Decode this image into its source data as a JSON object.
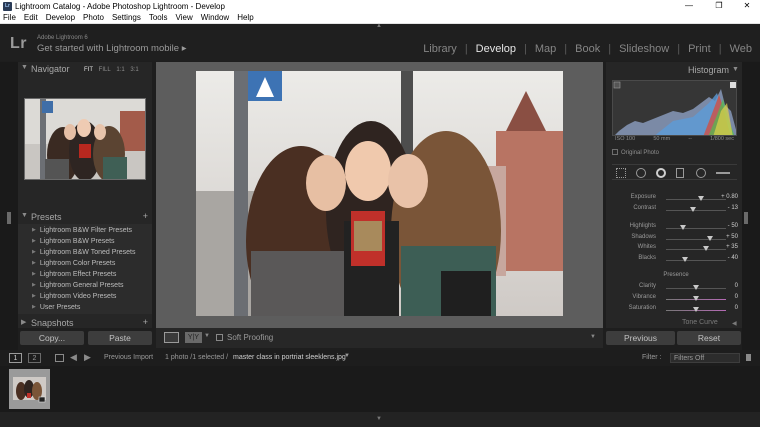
{
  "window": {
    "title": "Lightroom Catalog - Adobe Photoshop Lightroom - Develop",
    "controls": {
      "minimize": "—",
      "maximize": "❐",
      "close": "✕"
    }
  },
  "menu": [
    "File",
    "Edit",
    "Develop",
    "Photo",
    "Settings",
    "Tools",
    "View",
    "Window",
    "Help"
  ],
  "header": {
    "logo": "Lr",
    "product": "Adobe Lightroom 6",
    "mobile_prompt": "Get started with Lightroom mobile",
    "mobile_arrow": "▸",
    "modules": [
      "Library",
      "Develop",
      "Map",
      "Book",
      "Slideshow",
      "Print",
      "Web"
    ],
    "active_module": "Develop"
  },
  "left_panel": {
    "navigator": {
      "title": "Navigator",
      "options": [
        "FIT",
        "FILL",
        "1:1",
        "3:1"
      ],
      "active_option": "FIT"
    },
    "presets": {
      "title": "Presets",
      "add": "+",
      "items": [
        "Lightroom B&W Filter Presets",
        "Lightroom B&W Presets",
        "Lightroom B&W Toned Presets",
        "Lightroom Color Presets",
        "Lightroom Effect Presets",
        "Lightroom General Presets",
        "Lightroom Video Presets",
        "User Presets"
      ]
    },
    "snapshots": {
      "title": "Snapshots",
      "add": "+"
    },
    "copy_button": "Copy...",
    "paste_button": "Paste"
  },
  "toolbar": {
    "soft_proofing": "Soft Proofing",
    "yy_label": "Y|Y"
  },
  "right_panel": {
    "histogram": {
      "title": "Histogram",
      "iso": "ISO 100",
      "focal": "50 mm",
      "aperture": "--",
      "shutter": "1/800 sec",
      "original_photo": "Original Photo"
    },
    "sliders": [
      {
        "label": "Exposure",
        "value": "+ 0.80",
        "pos": 0.57
      },
      {
        "label": "Contrast",
        "value": "- 13",
        "pos": 0.44
      },
      {
        "label": "Highlights",
        "value": "- 50",
        "pos": 0.27
      },
      {
        "label": "Shadows",
        "value": "+ 50",
        "pos": 0.72
      },
      {
        "label": "Whites",
        "value": "+ 35",
        "pos": 0.66
      },
      {
        "label": "Blacks",
        "value": "- 40",
        "pos": 0.3
      }
    ],
    "presence": {
      "title": "Presence",
      "sliders": [
        {
          "label": "Clarity",
          "value": "0",
          "pos": 0.5
        },
        {
          "label": "Vibrance",
          "value": "0",
          "pos": 0.5
        },
        {
          "label": "Saturation",
          "value": "0",
          "pos": 0.5
        }
      ]
    },
    "tone_curve": "Tone Curve",
    "previous_button": "Previous",
    "reset_button": "Reset"
  },
  "filmstrip": {
    "page1": "1",
    "page2": "2",
    "previous_import": "Previous Import",
    "selection": "1 photo /1 selected /",
    "filename": "master class in portriat sleeklens.jpg",
    "filter_label": "Filter :",
    "filter_value": "Filters Off"
  }
}
